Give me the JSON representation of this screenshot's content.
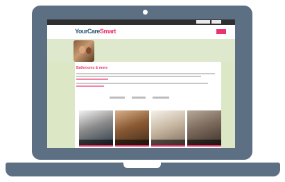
{
  "topbar": {
    "text": "",
    "login": "",
    "lang": ""
  },
  "logo": {
    "part1": "YourCare",
    "part2": "Smart"
  },
  "nav": {
    "links": [
      "",
      "",
      "",
      "",
      "",
      ""
    ],
    "donate": ""
  },
  "content": {
    "title": "Bathrooms & more"
  },
  "cards": [
    {
      "caption": ""
    },
    {
      "caption": ""
    },
    {
      "caption": ""
    },
    {
      "caption": ""
    }
  ],
  "colors": {
    "accent": "#e9356c",
    "frame": "#5d6f83",
    "green": "#dbe7c5"
  },
  "icons": {
    "camera": "camera-icon"
  }
}
